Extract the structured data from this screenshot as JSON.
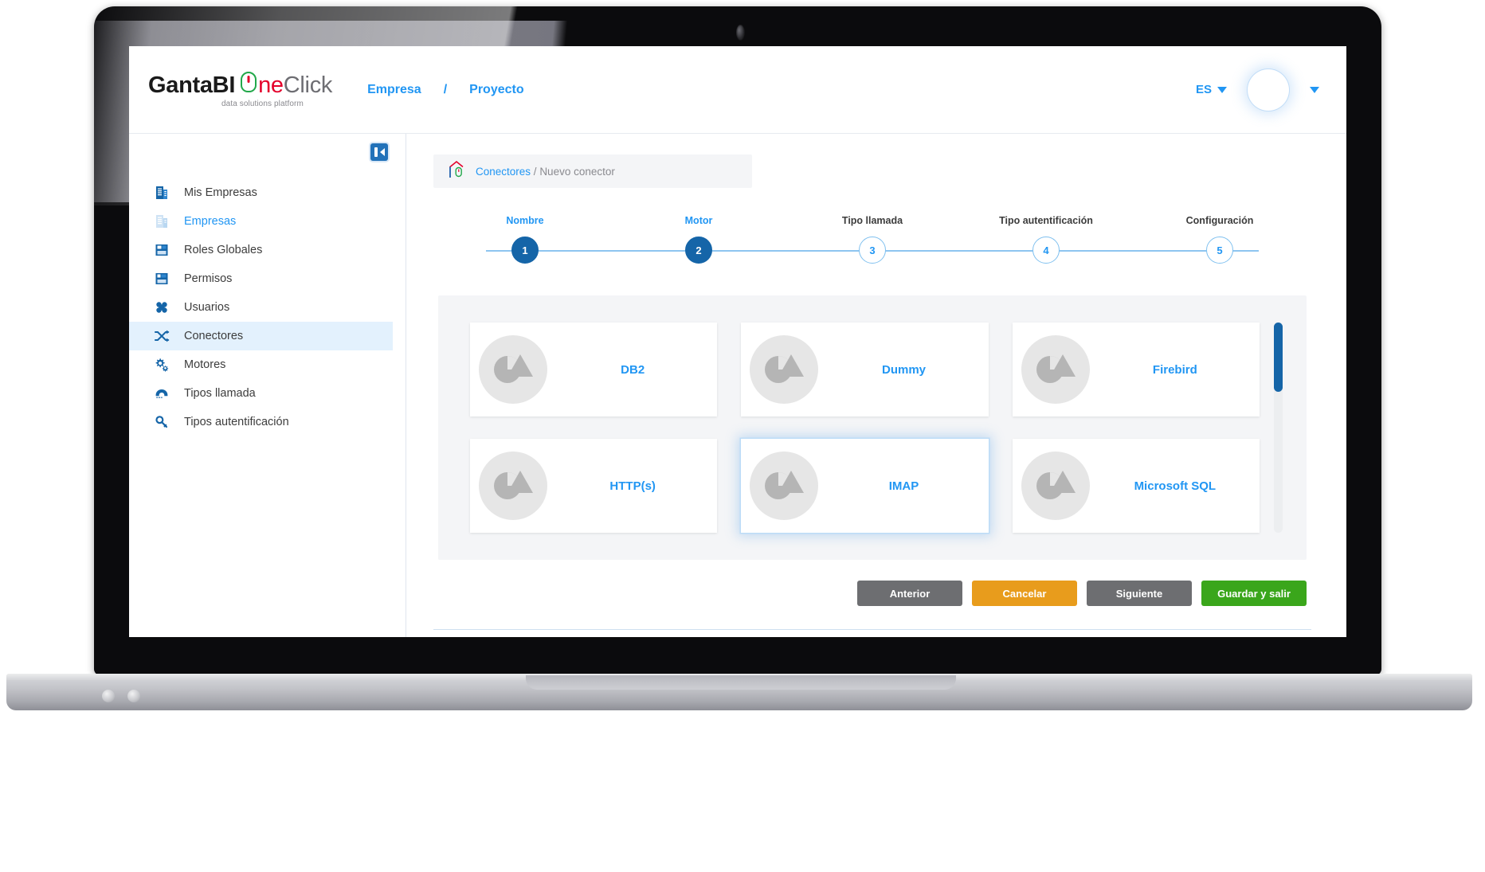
{
  "brand": {
    "name_dark": "GantaBI",
    "o_letter": "O",
    "name_red": "ne",
    "name_grey": "Click",
    "tagline": "data solutions platform",
    "green": "#22a84a",
    "red": "#e4002b",
    "grey": "#6e6e73"
  },
  "header": {
    "nav": [
      {
        "label": "Empresa"
      },
      {
        "label": "Proyecto"
      }
    ],
    "separator": "/",
    "language": "ES",
    "accent": "#2196f3"
  },
  "sidebar": {
    "items": [
      {
        "label": "Mis Empresas",
        "icon": "building-icon",
        "state": "default"
      },
      {
        "label": "Empresas",
        "icon": "building-light-icon",
        "state": "link"
      },
      {
        "label": "Roles Globales",
        "icon": "save-roles-icon",
        "state": "default"
      },
      {
        "label": "Permisos",
        "icon": "save-icon",
        "state": "default"
      },
      {
        "label": "Usuarios",
        "icon": "users-icon",
        "state": "default"
      },
      {
        "label": "Conectores",
        "icon": "connectors-icon",
        "state": "active"
      },
      {
        "label": "Motores",
        "icon": "gears-icon",
        "state": "default"
      },
      {
        "label": "Tipos llamada",
        "icon": "phone-icon",
        "state": "default"
      },
      {
        "label": "Tipos autentificación",
        "icon": "key-icon",
        "state": "default"
      }
    ],
    "highlight_color": "#e3f1fd"
  },
  "breadcrumb": {
    "link": "Conectores",
    "separator": " / ",
    "current": "Nuevo conector"
  },
  "stepper": {
    "steps": [
      {
        "number": "1",
        "label": "Nombre",
        "state": "done"
      },
      {
        "number": "2",
        "label": "Motor",
        "state": "done"
      },
      {
        "number": "3",
        "label": "Tipo llamada",
        "state": "pending"
      },
      {
        "number": "4",
        "label": "Tipo autentificación",
        "state": "pending"
      },
      {
        "number": "5",
        "label": "Configuración",
        "state": "pending"
      }
    ],
    "done_color": "#1565a8",
    "pending_color": "#2196f3"
  },
  "connectors": [
    {
      "name": "DB2",
      "selected": false
    },
    {
      "name": "Dummy",
      "selected": false
    },
    {
      "name": "Firebird",
      "selected": false
    },
    {
      "name": "HTTP(s)",
      "selected": false
    },
    {
      "name": "IMAP",
      "selected": true
    },
    {
      "name": "Microsoft SQL",
      "selected": false
    }
  ],
  "scrollbar": {
    "thumb_percent": 33
  },
  "actions": [
    {
      "label": "Anterior",
      "style": "grey"
    },
    {
      "label": "Cancelar",
      "style": "orange"
    },
    {
      "label": "Siguiente",
      "style": "grey"
    },
    {
      "label": "Guardar y salir",
      "style": "green"
    }
  ]
}
